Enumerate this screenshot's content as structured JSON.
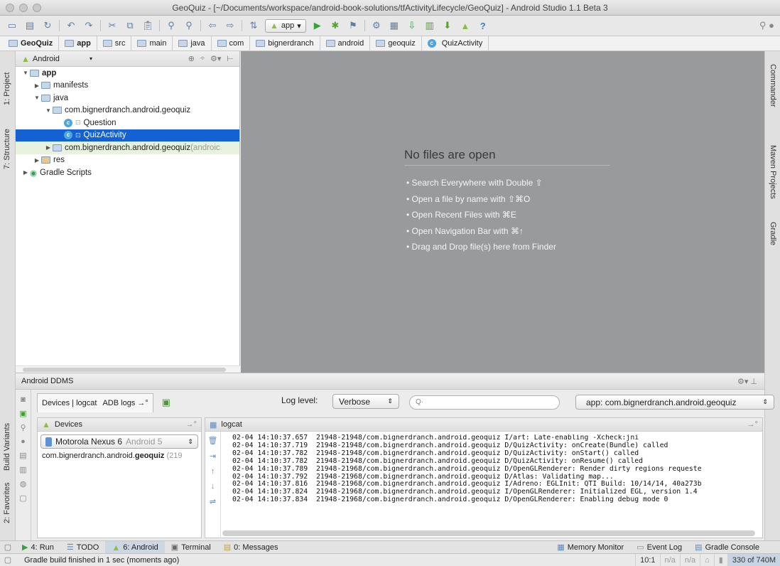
{
  "window": {
    "title": "GeoQuiz - [~/Documents/workspace/android-book-solutions/tfActivityLifecycle/GeoQuiz] - Android Studio 1.1 Beta 3"
  },
  "toolbar": {
    "run_config": "app",
    "help": "?"
  },
  "breadcrumbs": [
    "GeoQuiz",
    "app",
    "src",
    "main",
    "java",
    "com",
    "bignerdranch",
    "android",
    "geoquiz",
    "QuizActivity"
  ],
  "left_strip": {
    "project_tab": "1: Project",
    "structure_tab": "7: Structure",
    "build_variants_tab": "Build Variants",
    "favorites_tab": "2: Favorites"
  },
  "right_strip": {
    "commander_tab": "Commander",
    "maven_tab": "Maven Projects",
    "gradle_tab": "Gradle"
  },
  "project": {
    "view_mode": "Android",
    "tree": [
      {
        "label": "app",
        "depth": 0,
        "arrow": "down",
        "icon": "module-folder-icon",
        "bold": true
      },
      {
        "label": "manifests",
        "depth": 1,
        "arrow": "right",
        "icon": "folder-icon"
      },
      {
        "label": "java",
        "depth": 1,
        "arrow": "down",
        "icon": "folder-icon"
      },
      {
        "label": "com.bignerdranch.android.geoquiz",
        "depth": 2,
        "arrow": "down",
        "icon": "package-icon"
      },
      {
        "label": "Question",
        "depth": 3,
        "arrow": "",
        "icon": "class-icon"
      },
      {
        "label": "QuizActivity",
        "depth": 3,
        "arrow": "",
        "icon": "class-icon",
        "selected": true
      },
      {
        "label": "com.bignerdranch.android.geoquiz",
        "suffix": " (androic",
        "depth": 2,
        "arrow": "right",
        "icon": "package-icon",
        "tinted": true
      },
      {
        "label": "res",
        "depth": 1,
        "arrow": "right",
        "icon": "res-folder-icon"
      },
      {
        "label": "Gradle Scripts",
        "depth": 0,
        "arrow": "right",
        "icon": "gradle-icon"
      }
    ]
  },
  "editor": {
    "empty_title": "No files are open",
    "hints": [
      "• Search Everywhere with Double ⇧",
      "• Open a file by name with ⇧⌘O",
      "• Open Recent Files with ⌘E",
      "• Open Navigation Bar with ⌘↑",
      "• Drag and Drop file(s) here from Finder"
    ]
  },
  "ddms": {
    "title": "Android DDMS",
    "tab_devices": "Devices | logcat",
    "tab_adb": "ADB logs",
    "log_level_label": "Log level:",
    "log_level_value": "Verbose",
    "search_placeholder": "Q·",
    "app_filter": "app: com.bignerdranch.android.geoquiz",
    "devices_header": "Devices",
    "device_name": "Motorola Nexus 6",
    "device_os": "Android 5",
    "process_prefix": "com.bignerdranch.android.",
    "process_bold": "geoquiz",
    "process_suffix": " (219",
    "logcat_header": "logcat",
    "log_lines": [
      "02-04 14:10:37.657  21948-21948/com.bignerdranch.android.geoquiz I/art: Late-enabling -Xcheck:jni",
      "02-04 14:10:37.719  21948-21948/com.bignerdranch.android.geoquiz D/QuizActivity: onCreate(Bundle) called",
      "02-04 14:10:37.782  21948-21948/com.bignerdranch.android.geoquiz D/QuizActivity: onStart() called",
      "02-04 14:10:37.782  21948-21948/com.bignerdranch.android.geoquiz D/QuizActivity: onResume() called",
      "02-04 14:10:37.789  21948-21968/com.bignerdranch.android.geoquiz D/OpenGLRenderer: Render dirty regions requeste",
      "02-04 14:10:37.792  21948-21968/com.bignerdranch.android.geoquiz D/Atlas: Validating map...",
      "02-04 14:10:37.816  21948-21968/com.bignerdranch.android.geoquiz I/Adreno: EGLInit: QTI Build: 10/14/14, 40a273b",
      "02-04 14:10:37.824  21948-21968/com.bignerdranch.android.geoquiz I/OpenGLRenderer: Initialized EGL, version 1.4",
      "02-04 14:10:37.834  21948-21968/com.bignerdranch.android.geoquiz D/OpenGLRenderer: Enabling debug mode 0"
    ]
  },
  "bottom_tabs": {
    "run": "4: Run",
    "todo": "TODO",
    "android": "6: Android",
    "terminal": "Terminal",
    "messages": "0: Messages",
    "memory": "Memory Monitor",
    "event_log": "Event Log",
    "gradle_console": "Gradle Console"
  },
  "status": {
    "message": "Gradle build finished in 1 sec (moments ago)",
    "position": "10:1",
    "na1": "n/a",
    "na2": "n/a",
    "memory": "330 of 740M"
  },
  "colors": {
    "selection": "#1361d3",
    "editor_bg": "#999a9b",
    "android_green": "#8bbf3f"
  }
}
